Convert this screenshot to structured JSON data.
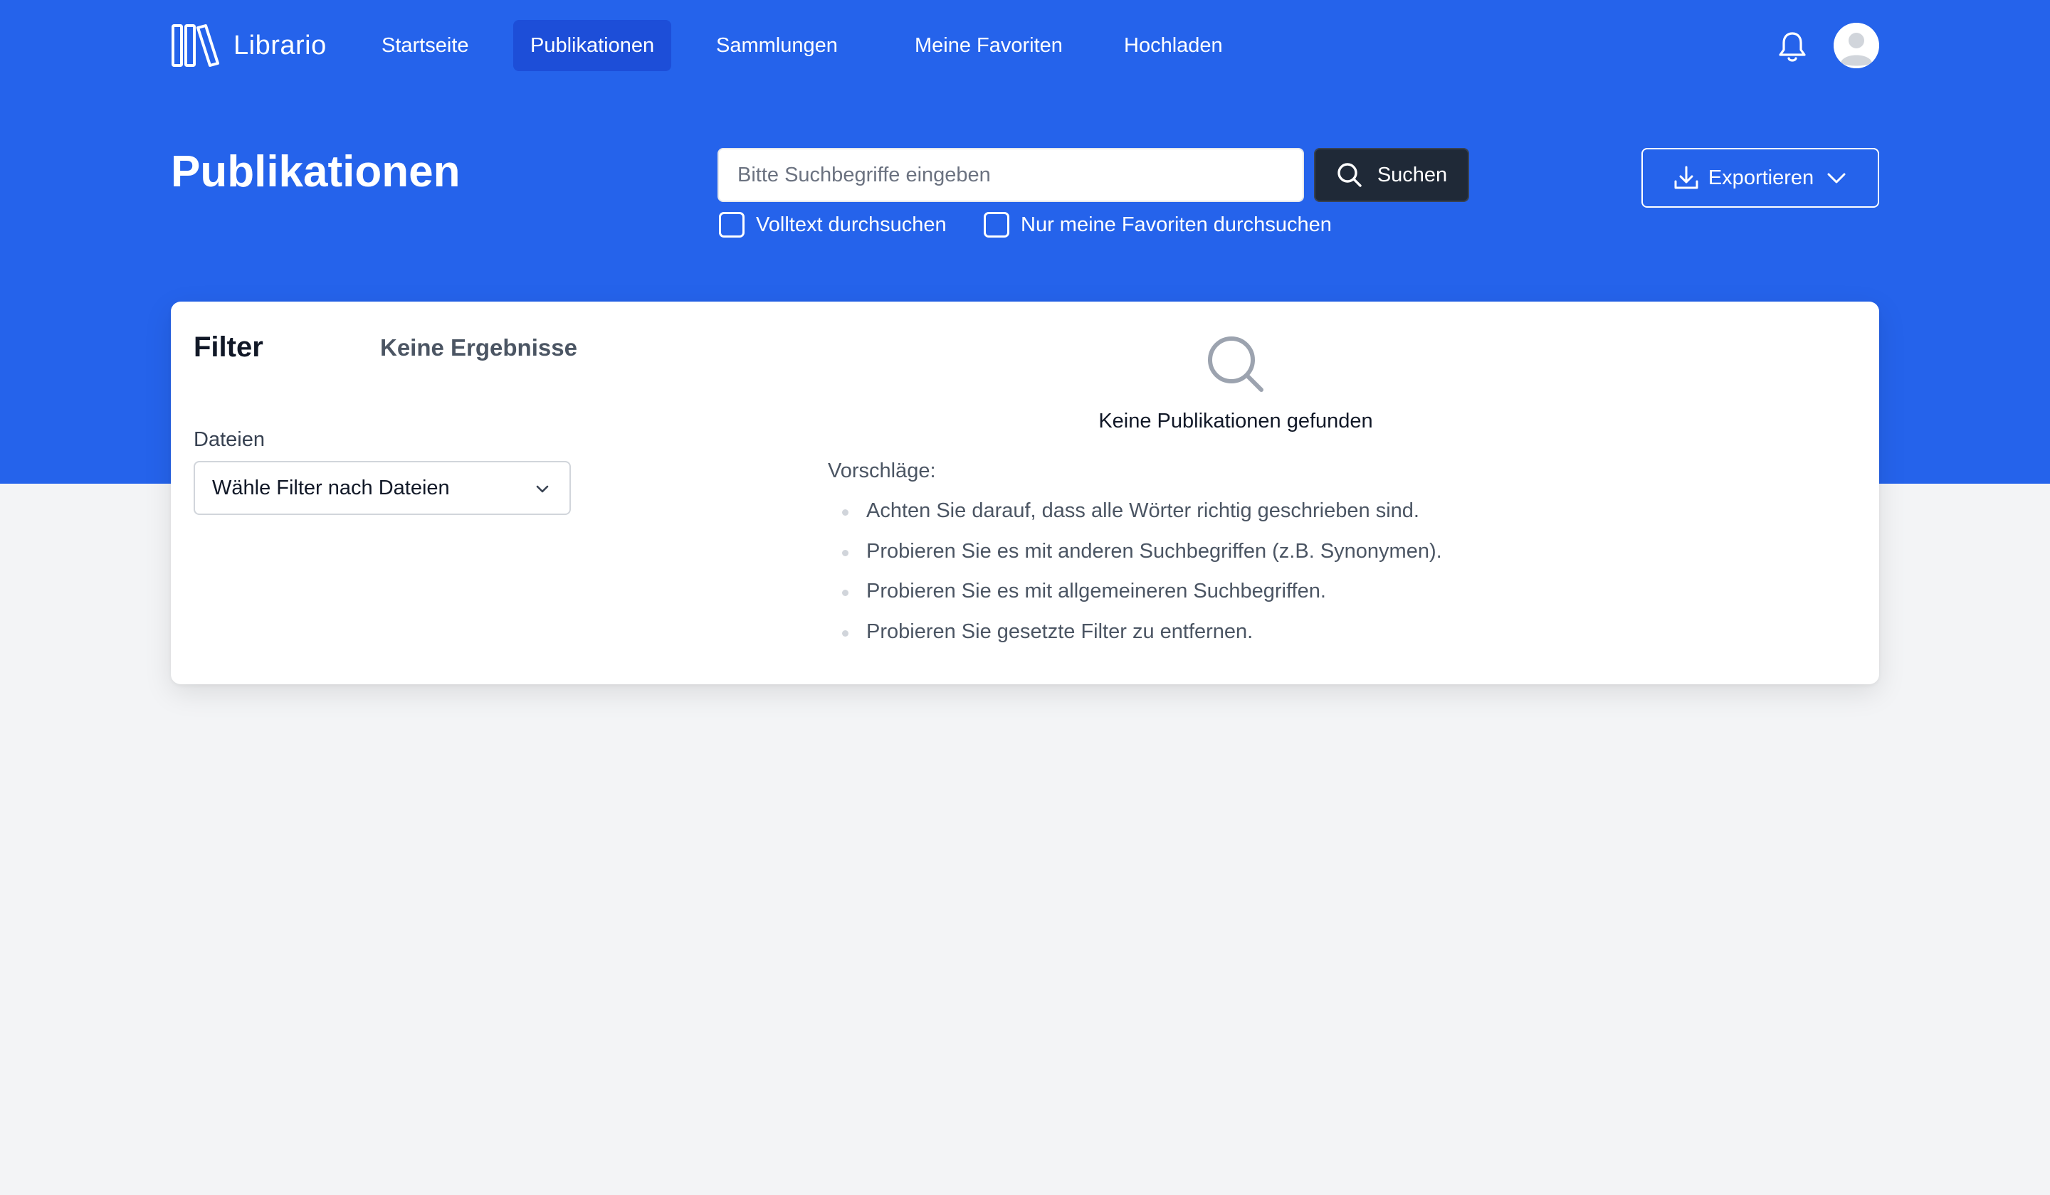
{
  "app": {
    "name": "Librario"
  },
  "nav": {
    "items": [
      {
        "label": "Startseite",
        "active": false
      },
      {
        "label": "Publikationen",
        "active": true
      },
      {
        "label": "Sammlungen",
        "active": false
      },
      {
        "label": "Meine Favoriten",
        "active": false
      },
      {
        "label": "Hochladen",
        "active": false
      }
    ]
  },
  "header": {
    "title": "Publikationen",
    "search": {
      "placeholder": "Bitte Suchbegriffe eingeben",
      "value": "",
      "button_label": "Suchen"
    },
    "options": {
      "fulltext_label": "Volltext durchsuchen",
      "fulltext_checked": false,
      "favorites_label": "Nur meine Favoriten durchsuchen",
      "favorites_checked": false
    },
    "export_label": "Exportieren"
  },
  "filter": {
    "title": "Filter",
    "results_label": "Keine Ergebnisse",
    "files_label": "Dateien",
    "files_select_value": "Wähle Filter nach Dateien"
  },
  "empty_state": {
    "title": "Keine Publikationen gefunden",
    "suggestions_label": "Vorschläge:",
    "suggestions": [
      "Achten Sie darauf, dass alle Wörter richtig geschrieben sind.",
      "Probieren Sie es mit anderen Suchbegriffen (z.B. Synonymen).",
      "Probieren Sie es mit allgemeineren Suchbegriffen.",
      "Probieren Sie gesetzte Filter zu entfernen."
    ]
  },
  "colors": {
    "brand": "#2563eb",
    "brand_dark": "#1d4ed8",
    "search_button": "#1f2937",
    "background": "#f3f4f6"
  },
  "icons": [
    "library-logo-icon",
    "bell-icon",
    "user-avatar-icon",
    "search-icon",
    "download-icon",
    "chevron-down-icon",
    "magnifier-empty-icon"
  ]
}
